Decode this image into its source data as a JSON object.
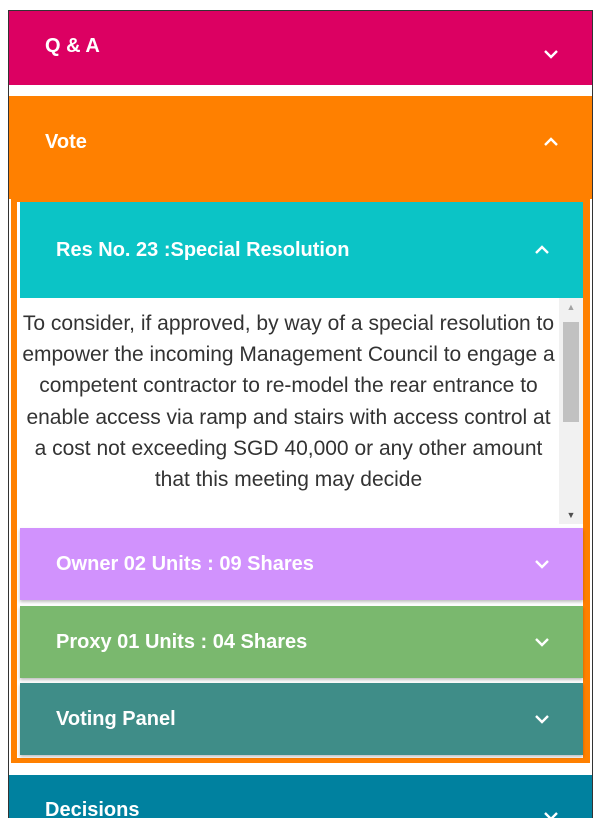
{
  "qa": {
    "title": "Q & A"
  },
  "vote": {
    "title": "Vote"
  },
  "resolution": {
    "title": "Res No. 23 :Special Resolution",
    "body": "To consider, if approved, by way of a special resolution to empower the incoming Management Council to engage a competent contractor to re-model the rear entrance to enable access via ramp and stairs with access control at a cost not exceeding SGD 40,000 or any other amount that this meeting may decide"
  },
  "owner": {
    "title": "Owner 02 Units : 09 Shares"
  },
  "proxy": {
    "title": "Proxy 01 Units : 04 Shares"
  },
  "voting_panel": {
    "title": "Voting Panel"
  },
  "decisions": {
    "title": "Decisions"
  },
  "colors": {
    "qa": "#dc0062",
    "vote": "#ff8000",
    "resolution": "#0bc4c6",
    "owner": "#d192fd",
    "proxy": "#7ab86e",
    "voting_panel": "#3f8d88",
    "decisions": "#00819f"
  },
  "icons": {
    "collapsed": "chevron-down-icon",
    "expanded": "chevron-up-icon"
  }
}
